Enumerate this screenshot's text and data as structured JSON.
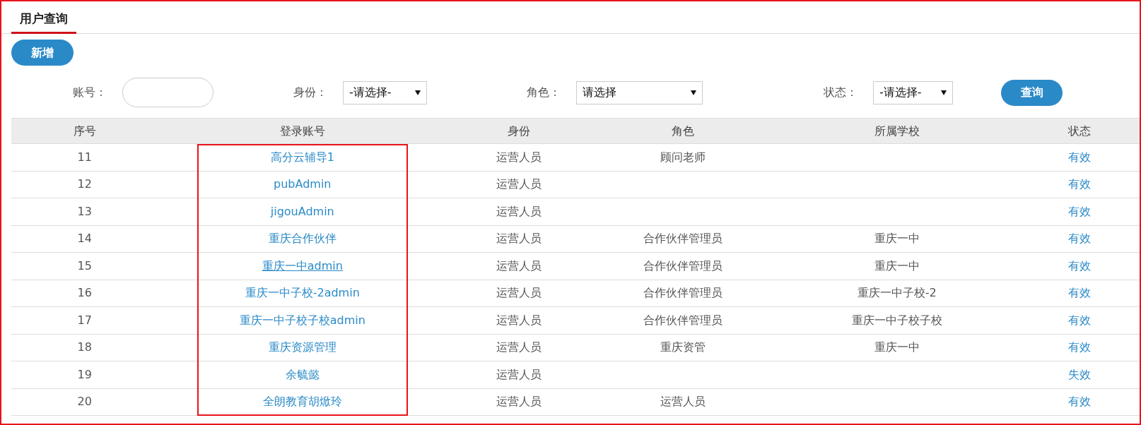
{
  "tabs": [
    {
      "label": "用户查询",
      "selected": true
    }
  ],
  "add_button": "新增",
  "filters": [
    {
      "kind": "text",
      "label": "账号："
    },
    {
      "kind": "select",
      "label": "身份：",
      "value": "-请选择-"
    },
    {
      "kind": "select",
      "label": "角色：",
      "value": "请选择"
    },
    {
      "kind": "select",
      "label": "状态：",
      "value": "-请选择-"
    }
  ],
  "search_button": "查询",
  "table": {
    "columns": [
      {
        "label": "序号"
      },
      {
        "label": "登录账号"
      },
      {
        "label": "身份"
      },
      {
        "label": "角色"
      },
      {
        "label": "所属学校"
      },
      {
        "label": "状态"
      }
    ],
    "annotation": {
      "kind": "outline"
    },
    "rows": [
      {
        "no": "11",
        "account": "高分云辅导1",
        "hovered": false,
        "identity": "运营人员",
        "role": "顾问老师",
        "school": "",
        "status": "有效"
      },
      {
        "no": "12",
        "account": "pubAdmin",
        "hovered": false,
        "identity": "运营人员",
        "role": "",
        "school": "",
        "status": "有效"
      },
      {
        "no": "13",
        "account": "jigouAdmin",
        "hovered": false,
        "identity": "运营人员",
        "role": "",
        "school": "",
        "status": "有效"
      },
      {
        "no": "14",
        "account": "重庆合作伙伴",
        "hovered": false,
        "identity": "运营人员",
        "role": "合作伙伴管理员",
        "school": "重庆一中",
        "status": "有效"
      },
      {
        "no": "15",
        "account": "重庆一中admin",
        "hovered": true,
        "identity": "运营人员",
        "role": "合作伙伴管理员",
        "school": "重庆一中",
        "status": "有效"
      },
      {
        "no": "16",
        "account": "重庆一中子校-2admin",
        "hovered": false,
        "identity": "运营人员",
        "role": "合作伙伴管理员",
        "school": "重庆一中子校-2",
        "status": "有效"
      },
      {
        "no": "17",
        "account": "重庆一中子校子校admin",
        "hovered": false,
        "identity": "运营人员",
        "role": "合作伙伴管理员",
        "school": "重庆一中子校子校",
        "status": "有效"
      },
      {
        "no": "18",
        "account": "重庆资源管理",
        "hovered": false,
        "identity": "运营人员",
        "role": "重庆资管",
        "school": "重庆一中",
        "status": "有效"
      },
      {
        "no": "19",
        "account": "余毓懿",
        "hovered": false,
        "identity": "运营人员",
        "role": "",
        "school": "",
        "status": "失效"
      },
      {
        "no": "20",
        "account": "全朗教育胡焮玲",
        "hovered": false,
        "identity": "运营人员",
        "role": "运营人员",
        "school": "",
        "status": "有效"
      }
    ]
  }
}
